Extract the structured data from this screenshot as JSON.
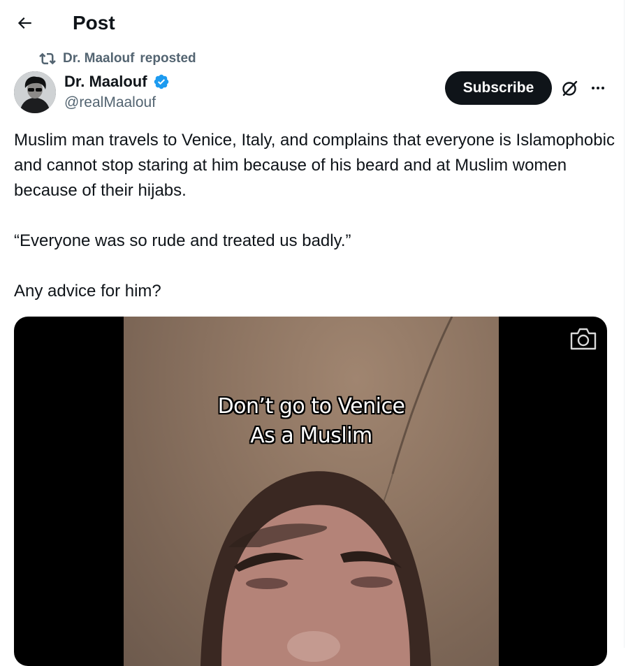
{
  "header": {
    "title": "Post",
    "back_icon": "arrow-left-icon"
  },
  "repost_banner": {
    "icon": "repost-icon",
    "name": "Dr. Maalouf",
    "verb": "reposted"
  },
  "author": {
    "display_name": "Dr. Maalouf",
    "handle": "@realMaalouf",
    "verified": true,
    "verified_color": "#1d9bf0"
  },
  "actions": {
    "subscribe_label": "Subscribe",
    "grok_icon": "grok-icon",
    "more_icon": "more-horizontal-icon"
  },
  "post": {
    "paragraphs": [
      "Muslim man travels to Venice, Italy, and complains that everyone is Islamophobic and cannot stop staring at him because of his beard and at Muslim women because of their hijabs.",
      "“Everyone was so rude and treated us badly.”",
      "Any advice for him?"
    ]
  },
  "media": {
    "caption_line1": "Don’t go to Venice",
    "caption_line2": "As a Muslim",
    "camera_icon": "camera-icon"
  },
  "colors": {
    "text": "#0f1419",
    "secondary": "#536471",
    "button_bg": "#0f1419"
  }
}
